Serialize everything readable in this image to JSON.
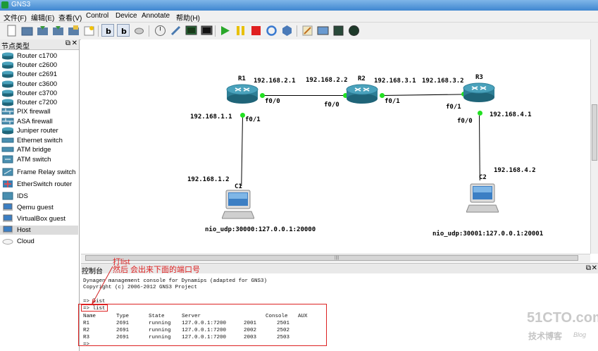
{
  "window": {
    "title": "GNS3"
  },
  "menu": [
    "文件(F)",
    "编辑(E)",
    "查看(V)",
    "Control",
    "Device",
    "Annotate",
    "帮助(H)"
  ],
  "toolbar": {
    "icons": [
      "new-project-icon",
      "open-project-icon",
      "save-project-icon",
      "save-as-icon",
      "open-folder-icon",
      "snapshot-icon",
      "show-hostnames-icon",
      "show-interface-labels-icon",
      "add-link-icon",
      "timer-icon",
      "telnet-all-icon",
      "console-icon",
      "console-all-icon",
      "start-icon",
      "suspend-icon",
      "stop-icon",
      "reload-icon",
      "virtualbox-icon",
      "add-note-icon",
      "insert-picture-icon",
      "draw-rectangle-icon",
      "draw-ellipse-icon"
    ]
  },
  "node_panel": {
    "title": "节点类型",
    "items": [
      {
        "label": "Router c1700",
        "icon": "router-icon"
      },
      {
        "label": "Router c2600",
        "icon": "router-icon"
      },
      {
        "label": "Router c2691",
        "icon": "router-icon"
      },
      {
        "label": "Router c3600",
        "icon": "router-icon"
      },
      {
        "label": "Router c3700",
        "icon": "router-icon"
      },
      {
        "label": "Router c7200",
        "icon": "router-icon"
      },
      {
        "label": "PIX firewall",
        "icon": "firewall-icon"
      },
      {
        "label": "ASA firewall",
        "icon": "firewall-icon"
      },
      {
        "label": "Juniper router",
        "icon": "router-icon"
      },
      {
        "label": "Ethernet switch",
        "icon": "ethernet-switch-icon"
      },
      {
        "label": "ATM bridge",
        "icon": "atm-bridge-icon"
      },
      {
        "label": "ATM switch",
        "icon": "atm-switch-icon"
      },
      {
        "label": "Frame Relay switch",
        "icon": "frame-relay-switch-icon"
      },
      {
        "label": "EtherSwitch router",
        "icon": "etherswitch-router-icon"
      },
      {
        "label": "IDS",
        "icon": "ids-icon"
      },
      {
        "label": "Qemu guest",
        "icon": "qemu-guest-icon"
      },
      {
        "label": "VirtualBox guest",
        "icon": "virtualbox-guest-icon"
      },
      {
        "label": "Host",
        "icon": "host-icon",
        "selected": true
      },
      {
        "label": "Cloud",
        "icon": "cloud-icon"
      }
    ]
  },
  "topology": {
    "routers": [
      {
        "name": "R1"
      },
      {
        "name": "R2"
      },
      {
        "name": "R3"
      }
    ],
    "hosts": [
      {
        "name": "C1",
        "nio": "nio_udp:30000:127.0.0.1:20000"
      },
      {
        "name": "C2",
        "nio": "nio_udp:30001:127.0.0.1:20001"
      }
    ],
    "addresses": {
      "r1_r2_left": "192.168.2.1",
      "r1_r2_right": "192.168.2.2",
      "r2_r3_left": "192.168.3.1",
      "r2_r3_right": "192.168.3.2",
      "r1_c1_router": "192.168.1.1",
      "r1_c1_host": "192.168.1.2",
      "r3_c2_router": "192.168.4.1",
      "r3_c2_host": "192.168.4.2"
    },
    "interfaces": {
      "r1_to_r2": "f0/0",
      "r2_to_r1": "f0/0",
      "r2_to_r3": "f0/1",
      "r3_to_r2": "f0/1",
      "r1_to_c1": "f0/1",
      "r3_to_c2": "f0/0"
    },
    "port_color": "#22e022"
  },
  "console": {
    "title": "控制台",
    "banner1": "Dynagen management console for Dynamips (adapted for GNS3)",
    "banner2": "Copyright (c) 2006-2012 GNS3 Project",
    "cmd1": "=> list",
    "cmd2": "=> list",
    "header": {
      "name": "Name",
      "type": "Type",
      "state": "State",
      "server": "Server",
      "console": "Console",
      "aux": "AUX"
    },
    "rows": [
      {
        "name": "R1",
        "type": "2691",
        "state": "running",
        "server": "127.0.0.1:7200",
        "port": "2001",
        "console": "2501"
      },
      {
        "name": "R2",
        "type": "2691",
        "state": "running",
        "server": "127.0.0.1:7200",
        "port": "2002",
        "console": "2502"
      },
      {
        "name": "R3",
        "type": "2691",
        "state": "running",
        "server": "127.0.0.1:7200",
        "port": "2003",
        "console": "2503"
      }
    ],
    "prompt": "=>"
  },
  "annotation": {
    "line1": "打list",
    "line2": "然后 会出来下面的端口号",
    "color": "#d22222"
  },
  "watermark": {
    "main": "51CTO.com",
    "sub": "技术博客",
    "blog": "Blog"
  }
}
